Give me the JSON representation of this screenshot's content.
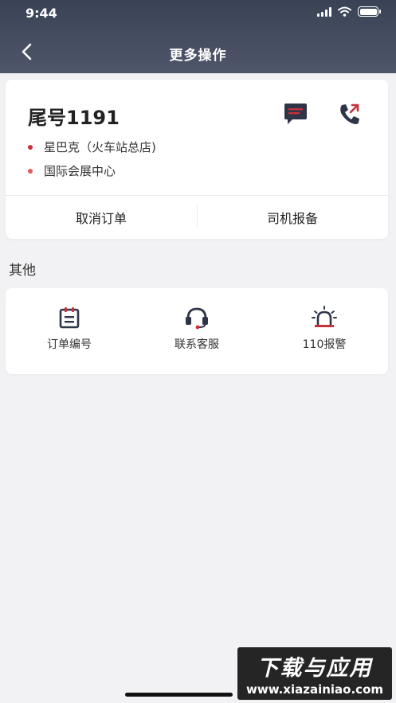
{
  "status_bar": {
    "time": "9:44"
  },
  "nav": {
    "title": "更多操作",
    "back_icon": "chevron-left-icon"
  },
  "trip": {
    "plate_tail": "尾号1191",
    "message_icon": "message-icon",
    "call_icon": "phone-call-icon",
    "addresses": [
      {
        "text": "星巴克（火车站总店)",
        "dot_color": "#c8303a"
      },
      {
        "text": "国际会展中心",
        "dot_color": "#e25a5a"
      }
    ],
    "actions": {
      "cancel": "取消订单",
      "report": "司机报备"
    }
  },
  "other": {
    "title": "其他",
    "items": [
      {
        "label": "订单编号",
        "icon": "clipboard-icon"
      },
      {
        "label": "联系客服",
        "icon": "headset-icon"
      },
      {
        "label": "110报警",
        "icon": "alarm-light-icon"
      }
    ]
  },
  "colors": {
    "header_bg": "#3a4256",
    "icon_dark": "#2e3548",
    "icon_accent": "#c8303a"
  },
  "watermark": {
    "top": "下载与应用",
    "bottom": "www.xiazainiao.com"
  }
}
